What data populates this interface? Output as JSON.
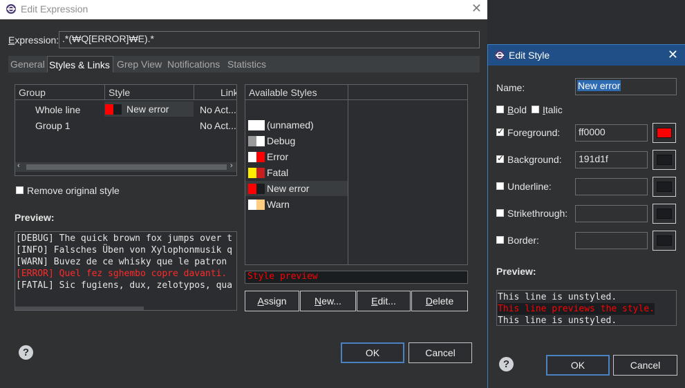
{
  "main_dialog": {
    "title": "Edit Expression",
    "expression_label": "Expression:",
    "expression_value": ".*(₩Q[ERROR]₩E).*",
    "tabs": [
      {
        "label": "General"
      },
      {
        "label": "Styles & Links",
        "active": true
      },
      {
        "label": "Grep View"
      },
      {
        "label": "Notifications"
      },
      {
        "label": "Statistics"
      }
    ],
    "groups_table": {
      "columns": [
        "Group",
        "Style",
        "Link"
      ],
      "rows": [
        {
          "group": "Whole line",
          "style": "New error",
          "link": "No Act..."
        },
        {
          "group": "Group 1",
          "style": "",
          "link": "No Act..."
        }
      ]
    },
    "remove_original_label": "Remove original style",
    "preview_label": "Preview:",
    "preview_lines": [
      {
        "text": "[DEBUG] The quick brown fox jumps over t",
        "color": "#e6e6e6"
      },
      {
        "text": "[INFO] Falsches Üben von Xylophonmusik q",
        "color": "#e6e6e6"
      },
      {
        "text": "[WARN] Buvez de ce whisky que le patron",
        "color": "#e6e6e6"
      },
      {
        "text": "[ERROR] Quel fez sghembo copre davanti.",
        "color": "#ff2a2a"
      },
      {
        "text": "[FATAL] Sic fugiens, dux, zelotypos, qua",
        "color": "#e6e6e6"
      }
    ],
    "available_styles_header": "Available Styles",
    "available_styles": [
      {
        "name": "(unnamed)",
        "fg": "#ffffff",
        "bg": "#ffffff"
      },
      {
        "name": "Debug",
        "fg": "#9a9a9a",
        "bg": "#ffffff"
      },
      {
        "name": "Error",
        "fg": "#ffffff",
        "bg": "#ff0000"
      },
      {
        "name": "Fatal",
        "fg": "#ffee00",
        "bg": "#c81e1e"
      },
      {
        "name": "New error",
        "fg": "#ff0000",
        "bg": "#191d1f",
        "selected": true
      },
      {
        "name": "Warn",
        "fg": "#ffffff",
        "bg": "#ffcc80"
      }
    ],
    "style_preview_text": "Style preview",
    "buttons": {
      "assign": "Assign",
      "new": "New...",
      "edit": "Edit...",
      "delete": "Delete",
      "ok": "OK",
      "cancel": "Cancel"
    }
  },
  "style_dialog": {
    "title": "Edit Style",
    "name_label": "Name:",
    "name_value": "New error",
    "bold_label": "Bold",
    "italic_label": "Italic",
    "rows": [
      {
        "label": "Foreground:",
        "checked": true,
        "value": "ff0000",
        "color": "#ff0000"
      },
      {
        "label": "Background:",
        "checked": true,
        "value": "191d1f",
        "color": "#191d1f"
      },
      {
        "label": "Underline:",
        "checked": false,
        "value": "",
        "color": "#191d1f"
      },
      {
        "label": "Strikethrough:",
        "checked": false,
        "value": "",
        "color": "#191d1f"
      },
      {
        "label": "Border:",
        "checked": false,
        "value": "",
        "color": "#191d1f"
      }
    ],
    "preview_label": "Preview:",
    "preview_lines": [
      {
        "text": "This line is unstyled.",
        "styled": false
      },
      {
        "text": "This line previews the style.",
        "styled": true
      },
      {
        "text": "This line is unstyled.",
        "styled": false
      }
    ],
    "buttons": {
      "ok": "OK",
      "cancel": "Cancel"
    }
  },
  "colors": {
    "accent": "#3b7fc4",
    "error_red": "#ff0000"
  }
}
